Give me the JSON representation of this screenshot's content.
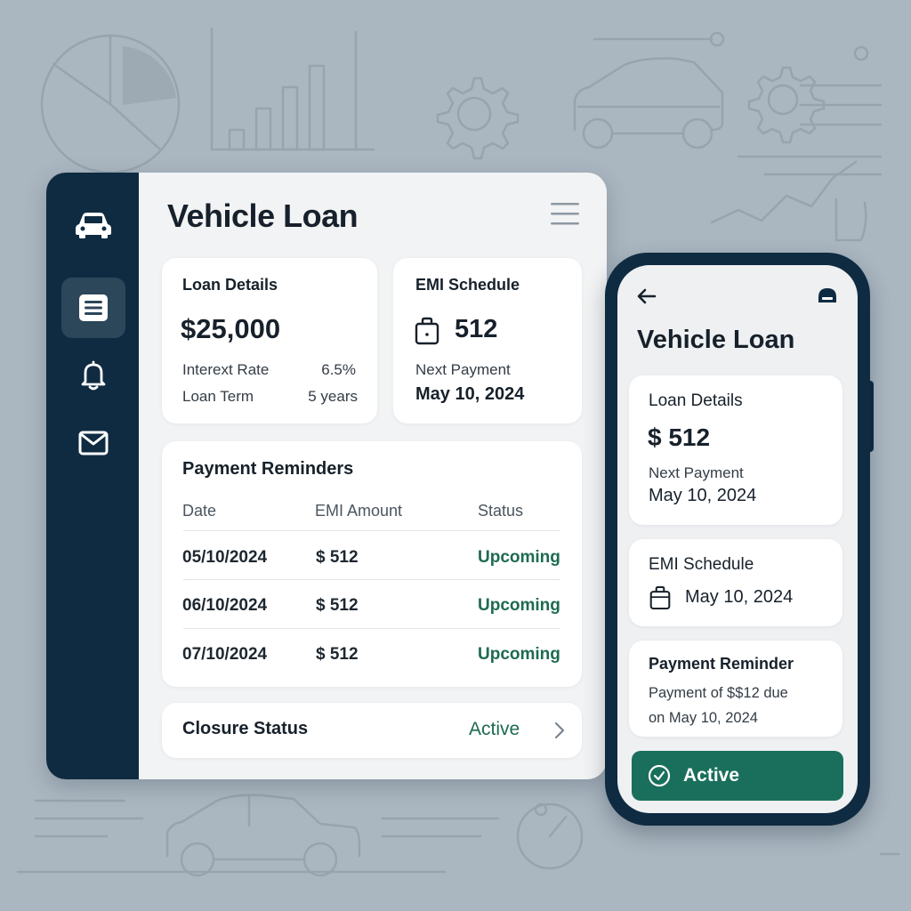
{
  "desktop": {
    "title": "Vehicle Loan",
    "sidebar": {
      "items": [
        {
          "name": "car-icon",
          "active": false
        },
        {
          "name": "document-list-icon",
          "active": true
        },
        {
          "name": "bell-icon",
          "active": false
        },
        {
          "name": "mail-icon",
          "active": false
        }
      ]
    },
    "loan_details": {
      "title": "Loan Details",
      "amount": "$25,000",
      "interest_label": "Interext Rate",
      "interest_value": "6.5%",
      "term_label": "Loan Term",
      "term_value": "5 years"
    },
    "emi_schedule": {
      "title": "EMI Schedule",
      "value": "512",
      "next_label": "Next Payment",
      "next_date": "May 10, 2024"
    },
    "reminders": {
      "title": "Payment Reminders",
      "columns": [
        "Date",
        "EMI Amount",
        "Status"
      ],
      "rows": [
        {
          "date": "05/10/2024",
          "amount": "$ 512",
          "status": "Upcoming"
        },
        {
          "date": "06/10/2024",
          "amount": "$ 512",
          "status": "Upcoming"
        },
        {
          "date": "07/10/2024",
          "amount": "$ 512",
          "status": "Upcoming"
        }
      ]
    },
    "closure": {
      "label": "Closure Status",
      "value": "Active"
    }
  },
  "mobile": {
    "title": "Vehicle Loan",
    "loan_details": {
      "title": "Loan Details",
      "amount": "$ 512",
      "next_label": "Next Payment",
      "next_date": "May 10, 2024"
    },
    "emi_schedule": {
      "title": "EMI Schedule",
      "date": "May 10, 2024"
    },
    "reminder": {
      "title": "Payment Reminder",
      "line1": "Payment of $$12 due",
      "line2": "on May 10, 2024"
    },
    "status_button": "Active"
  },
  "colors": {
    "background": "#aab6c0",
    "sidebar": "#0f2b42",
    "accent_green": "#196f5c",
    "status_text": "#1d6b50"
  }
}
